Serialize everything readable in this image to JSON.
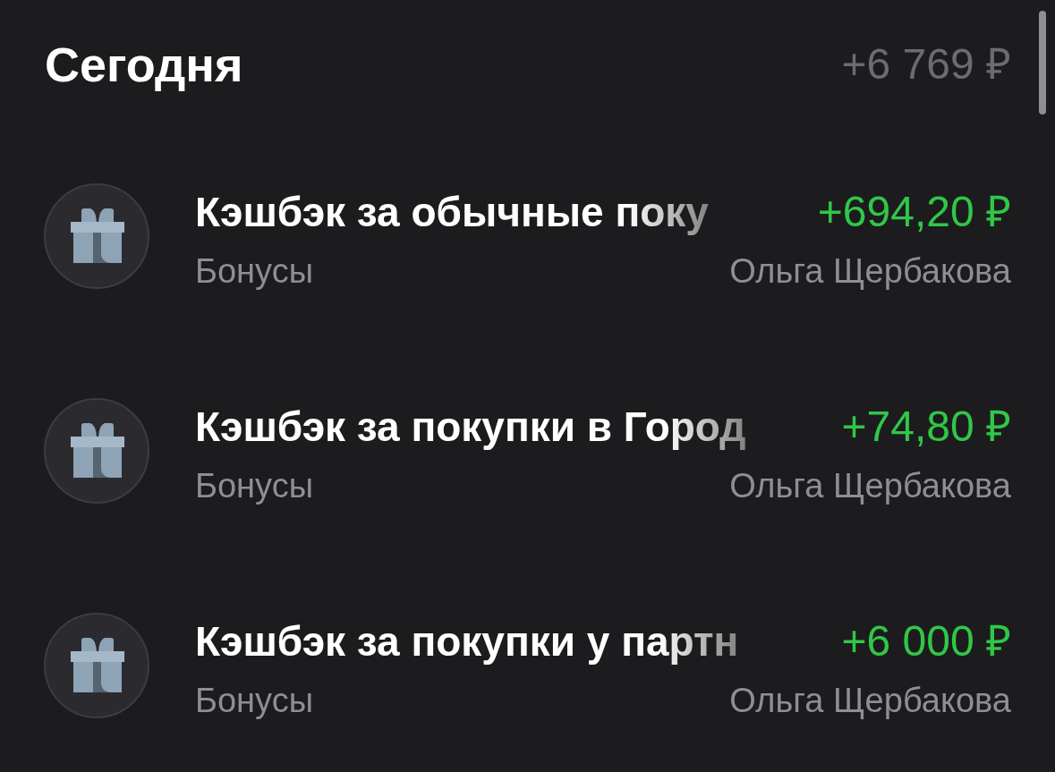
{
  "header": {
    "title": "Сегодня",
    "total": "+6 769 ₽"
  },
  "operations": [
    {
      "title": "Кэшбэк за обычные поку",
      "amount": "+694,20 ₽",
      "category": "Бонусы",
      "owner": "Ольга Щербакова"
    },
    {
      "title": "Кэшбэк за покупки в Город",
      "amount": "+74,80 ₽",
      "category": "Бонусы",
      "owner": "Ольга Щербакова"
    },
    {
      "title": "Кэшбэк за покупки у партн",
      "amount": "+6 000 ₽",
      "category": "Бонусы",
      "owner": "Ольга Щербакова"
    }
  ]
}
